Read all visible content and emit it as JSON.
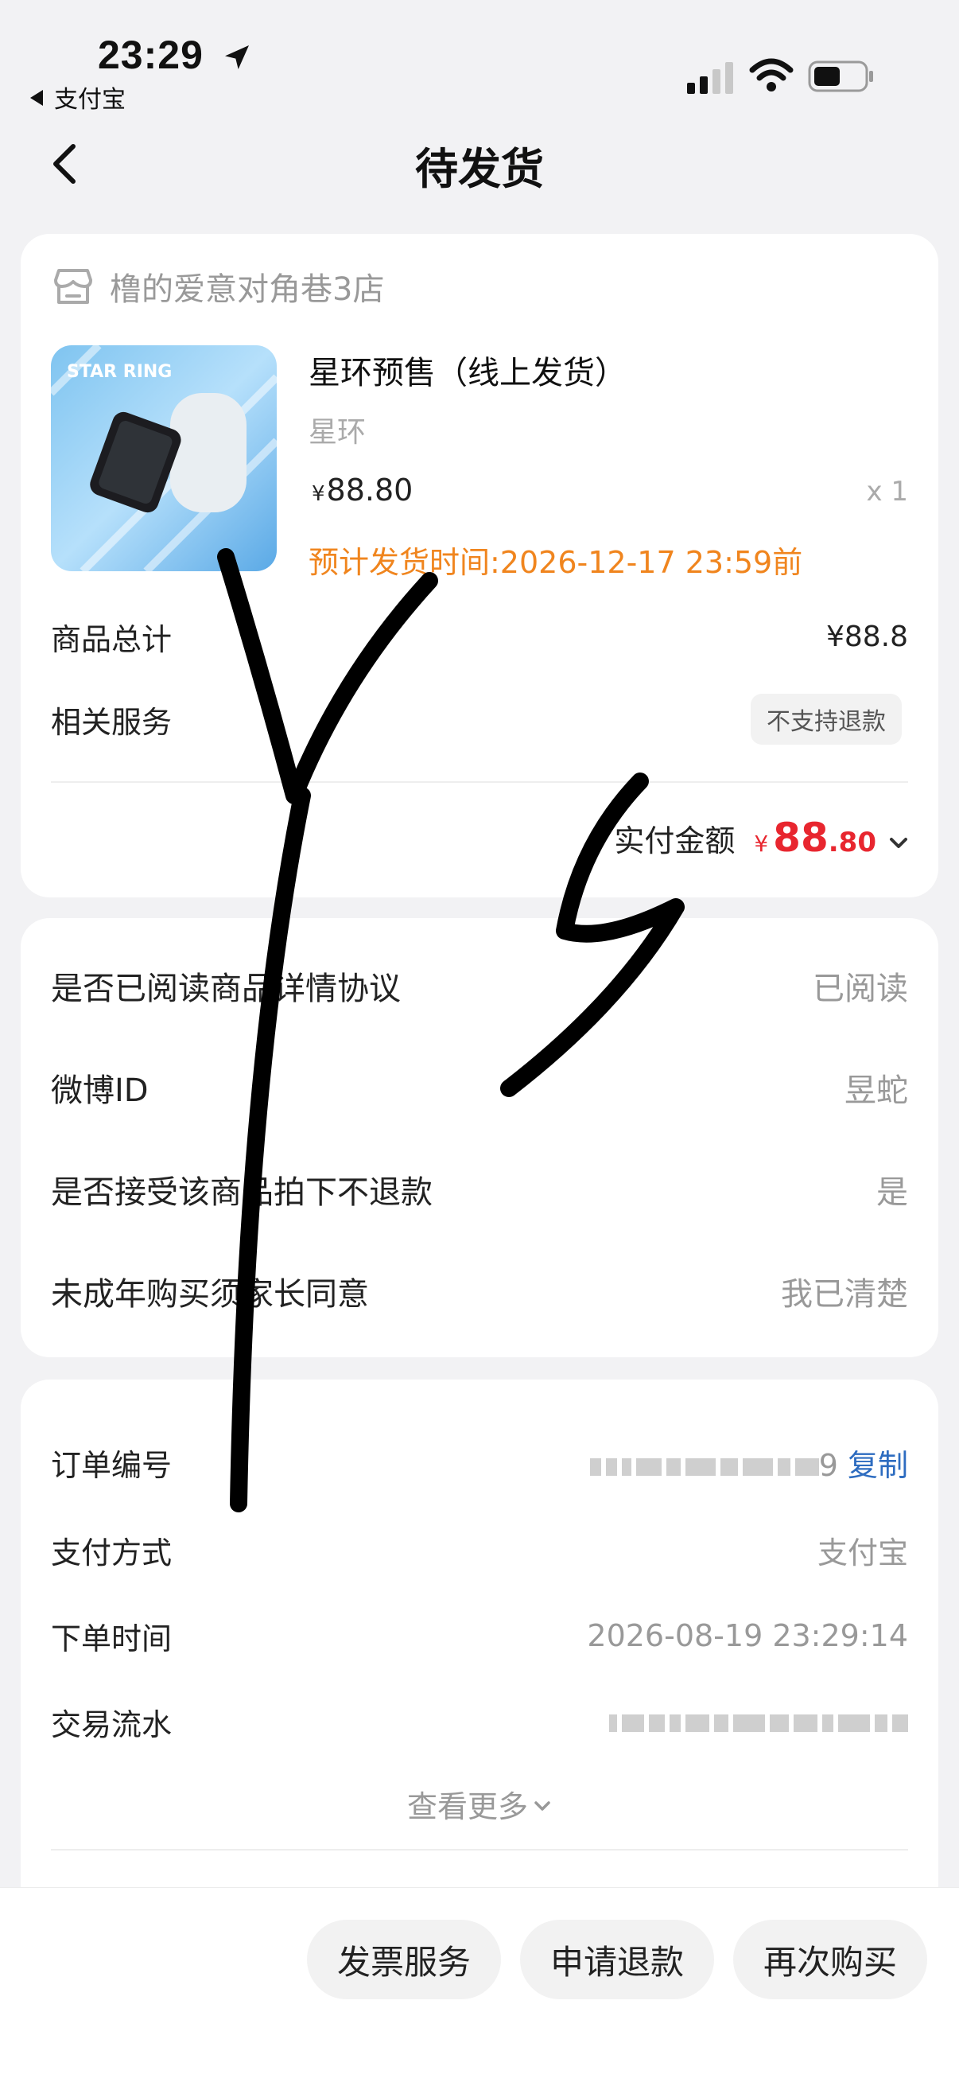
{
  "status_bar": {
    "time": "23:29",
    "back_app": "支付宝"
  },
  "header": {
    "title": "待发货"
  },
  "store": {
    "name": "橹的爱意对角巷3店"
  },
  "product": {
    "title": "星环预售（线上发货）",
    "variant": "星环",
    "price_currency": "¥",
    "price": "88.80",
    "quantity": "x 1",
    "ship_time": "预计发货时间:2026-12-17 23:59前"
  },
  "summary": {
    "total_label": "商品总计",
    "total_value": "¥88.8",
    "service_label": "相关服务",
    "service_badge": "不支持退款",
    "paid_label": "实付金额",
    "paid_currency": "¥",
    "paid_int": "88",
    "paid_dec": ".80"
  },
  "questions": [
    {
      "label": "是否已阅读商品详情协议",
      "value": "已阅读"
    },
    {
      "label": "微博ID",
      "value": "昱蛇"
    },
    {
      "label": "是否接受该商品拍下不退款",
      "value": "是"
    },
    {
      "label": "未成年购买须家长同意",
      "value": "我已清楚"
    }
  ],
  "order": {
    "number_label": "订单编号",
    "number_tail": "9",
    "copy_label": "复制",
    "payment_label": "支付方式",
    "payment_value": "支付宝",
    "time_label": "下单时间",
    "time_value": "2026-08-19 23:29:14",
    "serial_label": "交易流水",
    "more_label": "查看更多"
  },
  "actions": {
    "invoice": "发票服务",
    "refund": "申请退款",
    "rebuy": "再次购买"
  },
  "colors": {
    "accent_orange": "#f0851e",
    "price_red": "#e8262f",
    "link_blue": "#2d6cc0"
  }
}
